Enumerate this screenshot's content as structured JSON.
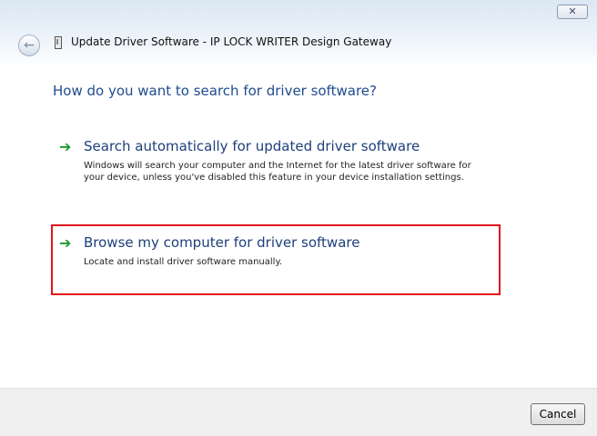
{
  "window": {
    "title": "Update Driver Software - IP LOCK WRITER  Design Gateway",
    "close_glyph": "✕",
    "back_glyph": "←"
  },
  "main": {
    "question": "How do you want to search for driver software?",
    "options": [
      {
        "title": "Search automatically for updated driver software",
        "description": "Windows will search your computer and the Internet for the latest driver software for your device, unless you've disabled this feature in your device installation settings.",
        "icon": "green-arrow-icon"
      },
      {
        "title": "Browse my computer for driver software",
        "description": "Locate and install driver software manually.",
        "icon": "green-arrow-icon"
      }
    ]
  },
  "footer": {
    "cancel_label": "Cancel"
  },
  "colors": {
    "accent": "#1e4c8e",
    "arrow": "#1c9a2e",
    "highlight": "#e0141c"
  }
}
